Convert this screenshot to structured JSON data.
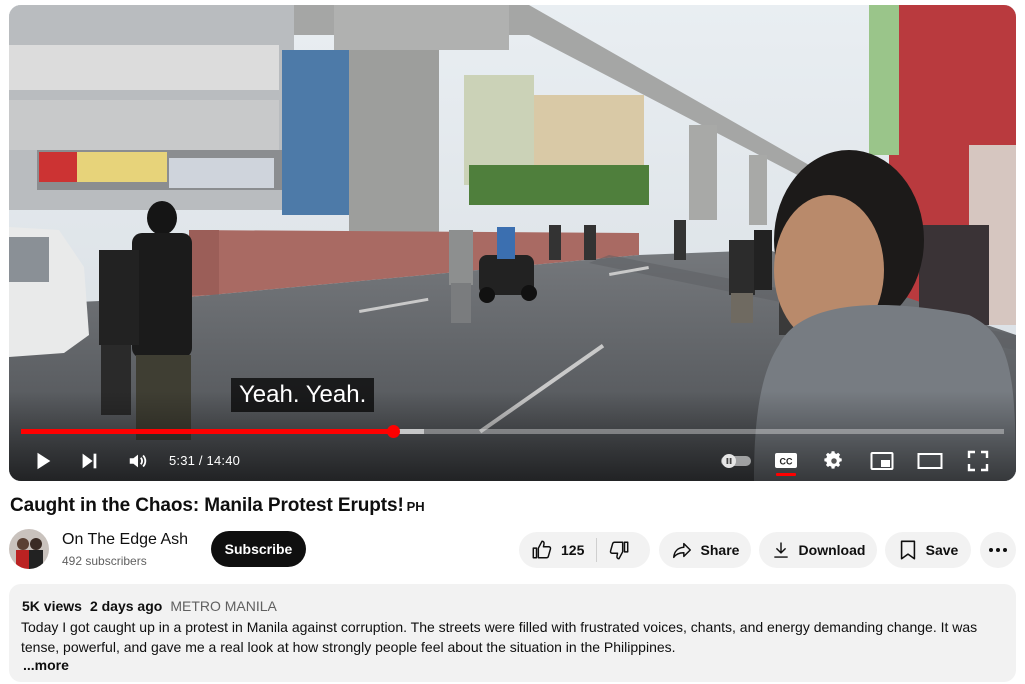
{
  "player": {
    "caption": "Yeah. Yeah.",
    "time_display": "5:31 / 14:40",
    "progress": {
      "played_fraction": 0.378,
      "loaded_fraction": 0.41
    },
    "icons": {
      "play": "play-icon",
      "next": "next-icon",
      "volume": "volume-icon",
      "autoplay": "autoplay-toggle-icon",
      "captions": "cc-icon",
      "settings": "gear-icon",
      "miniplayer": "miniplayer-icon",
      "theater": "theater-mode-icon",
      "fullscreen": "fullscreen-icon"
    },
    "accent_color": "#ff0000"
  },
  "video": {
    "title": "Caught in the Chaos: Manila Protest Erupts!",
    "title_suffix": "PH"
  },
  "channel": {
    "name": "On The Edge Ash",
    "subscribers": "492 subscribers",
    "subscribe_label": "Subscribe"
  },
  "actions": {
    "like_count": "125",
    "share_label": "Share",
    "download_label": "Download",
    "save_label": "Save"
  },
  "description": {
    "views": "5K views",
    "date": "2 days ago",
    "location": "METRO MANILA",
    "text": "Today I got caught up in a protest in Manila against corruption. The streets were filled with frustrated voices, chants, and energy demanding change. It was tense, powerful, and gave me a real look at how strongly people feel about the situation in the Philippines.",
    "more_label": "...more"
  }
}
